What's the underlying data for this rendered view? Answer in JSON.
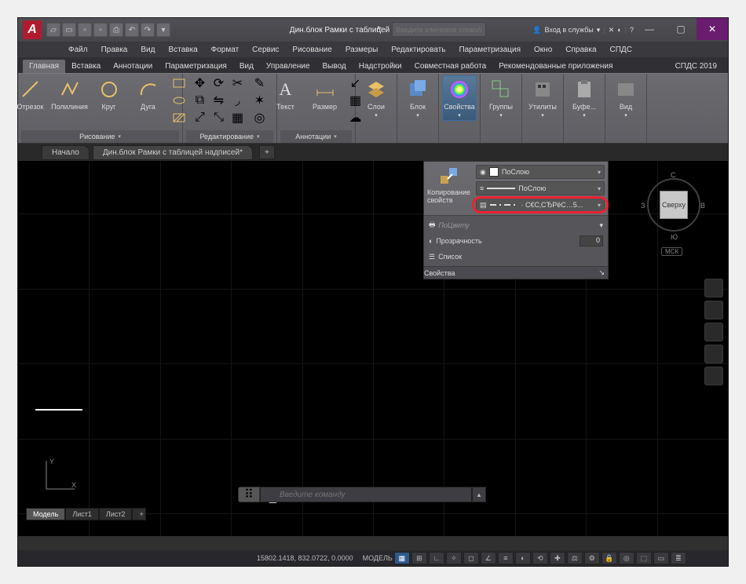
{
  "app_letter": "A",
  "title": "Дин.блок Рамки с таблицей надписи...",
  "search_placeholder": "Введите ключевое слово/фразу",
  "login_label": "Вход в службы",
  "menu": [
    "Файл",
    "Правка",
    "Вид",
    "Вставка",
    "Формат",
    "Сервис",
    "Рисование",
    "Размеры",
    "Редактировать",
    "Параметризация",
    "Окно",
    "Справка",
    "СПДС"
  ],
  "ribbon_tabs": [
    "Главная",
    "Вставка",
    "Аннотации",
    "Параметризация",
    "Вид",
    "Управление",
    "Вывод",
    "Надстройки",
    "Совместная работа",
    "Рекомендованные приложения"
  ],
  "ribbon_tabs_right": "СПДС 2019",
  "panels": {
    "draw": {
      "items": [
        "Отрезок",
        "Полилиния",
        "Круг",
        "Дуга"
      ],
      "footer": "Рисование"
    },
    "edit": {
      "footer": "Редактирование"
    },
    "annot": {
      "items": [
        "Текст",
        "Размер"
      ],
      "footer": "Аннотации"
    },
    "layers": {
      "label": "Слои"
    },
    "block": {
      "label": "Блок"
    },
    "props": {
      "label": "Свойства"
    },
    "groups": {
      "label": "Группы"
    },
    "utils": {
      "label": "Утилиты"
    },
    "clip": {
      "label": "Буфе..."
    },
    "view": {
      "label": "Вид"
    }
  },
  "doc_tabs": {
    "start": "Начало",
    "file": "Дин.блок Рамки с таблицей надписей*"
  },
  "flyout": {
    "copy_label": "Копирование свойств",
    "row_color": "ПоСлою",
    "row_lw": "ПоСлою",
    "row_lt": "· С€С‚СЂРёС…5...",
    "row_plot": "ПоЦвету",
    "row_trans_label": "Прозрачность",
    "row_trans_val": "0",
    "row_list": "Список",
    "footer": "Свойства"
  },
  "viewcube": {
    "face": "Сверху",
    "n": "С",
    "s": "Ю",
    "e": "В",
    "w": "З",
    "coord": "МСК"
  },
  "cmd_placeholder": "Введите команду",
  "layout_tabs": [
    "Модель",
    "Лист1",
    "Лист2"
  ],
  "status": {
    "coords": "15802.1418, 832.0722, 0.0000",
    "model": "МОДЕЛЬ"
  }
}
